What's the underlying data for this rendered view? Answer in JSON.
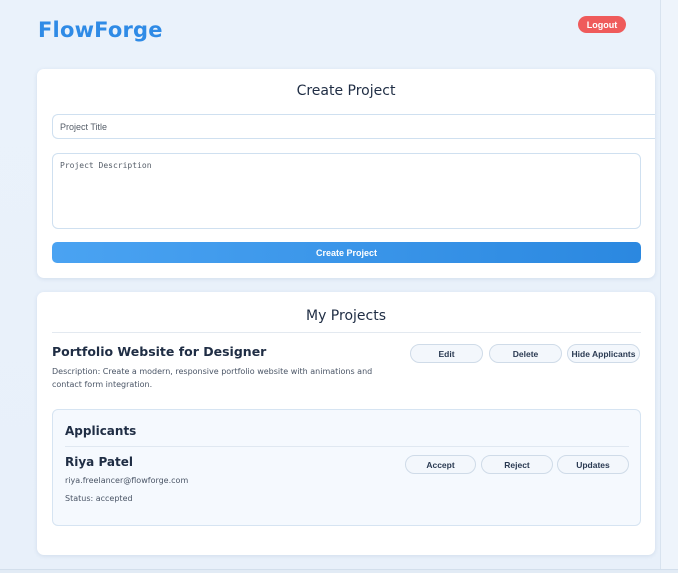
{
  "header": {
    "logo": "FlowForge",
    "logout_label": "Logout"
  },
  "create_project": {
    "title": "Create Project",
    "title_placeholder": "Project Title",
    "title_value": "",
    "description_placeholder": "Project Description",
    "description_value": "",
    "submit_label": "Create Project"
  },
  "my_projects": {
    "title": "My Projects",
    "projects": [
      {
        "name": "Portfolio Website for Designer",
        "description": "Description: Create a modern, responsive portfolio website with animations and contact form integration.",
        "edit_label": "Edit",
        "delete_label": "Delete",
        "hide_applicants_label": "Hide Applicants",
        "applicants_title": "Applicants",
        "applicants": [
          {
            "name": "Riya Patel",
            "email": "riya.freelancer@flowforge.com",
            "status": "Status: accepted",
            "accept_label": "Accept",
            "reject_label": "Reject",
            "updates_label": "Updates"
          }
        ]
      }
    ]
  },
  "colors": {
    "brand": "#2f8be6",
    "logout": "#ef5b5b",
    "primary_button": "#3596e8"
  }
}
